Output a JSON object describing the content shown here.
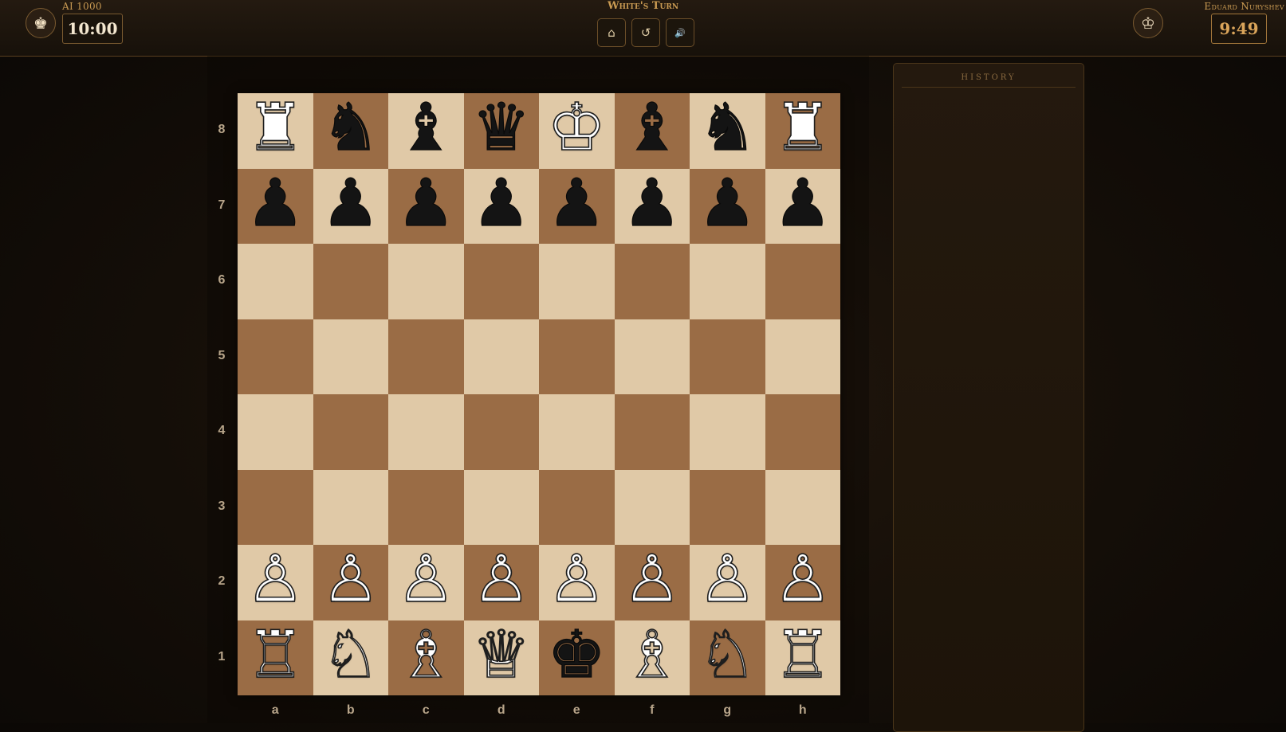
{
  "header": {
    "turn_text": "White's Turn",
    "opponent": {
      "name": "AI 1000",
      "clock": "10:00",
      "avatar_glyph": "♚"
    },
    "player": {
      "name": "Eduard Nuryshev",
      "clock": "9:49",
      "avatar_glyph": "♔"
    },
    "controls": {
      "home_icon": "⌂",
      "restart_icon": "↺",
      "sound_icon": "🔊"
    }
  },
  "board": {
    "light_color": "#e0c9a7",
    "dark_color": "#9a6c45",
    "ranks": [
      "8",
      "7",
      "6",
      "5",
      "4",
      "3",
      "2",
      "1"
    ],
    "files": [
      "a",
      "b",
      "c",
      "d",
      "e",
      "f",
      "g",
      "h"
    ],
    "rows": [
      [
        "♜",
        "♞",
        "♝",
        "♛",
        "♔",
        "♝",
        "♞",
        "♜"
      ],
      [
        "♟",
        "♟",
        "♟",
        "♟",
        "♟",
        "♟",
        "♟",
        "♟"
      ],
      [
        "",
        "",
        "",
        "",
        "",
        "",
        "",
        ""
      ],
      [
        "",
        "",
        "",
        "",
        "",
        "",
        "",
        ""
      ],
      [
        "",
        "",
        "",
        "",
        "",
        "",
        "",
        ""
      ],
      [
        "",
        "",
        "",
        "",
        "",
        "",
        "",
        ""
      ],
      [
        "♙",
        "♙",
        "♙",
        "♙",
        "♙",
        "♙",
        "♙",
        "♙"
      ],
      [
        "♖",
        "♘",
        "♗",
        "♕",
        "♚",
        "♗",
        "♘",
        "♖"
      ]
    ],
    "piece_colors": [
      [
        "white",
        "black",
        "black",
        "black",
        "white",
        "black",
        "black",
        "white"
      ],
      [
        "black",
        "black",
        "black",
        "black",
        "black",
        "black",
        "black",
        "black"
      ],
      [
        "",
        "",
        "",
        "",
        "",
        "",
        "",
        ""
      ],
      [
        "",
        "",
        "",
        "",
        "",
        "",
        "",
        ""
      ],
      [
        "",
        "",
        "",
        "",
        "",
        "",
        "",
        ""
      ],
      [
        "",
        "",
        "",
        "",
        "",
        "",
        "",
        ""
      ],
      [
        "white",
        "white",
        "white",
        "white",
        "white",
        "white",
        "white",
        "white"
      ],
      [
        "white",
        "white",
        "white",
        "white",
        "black",
        "white",
        "white",
        "white"
      ]
    ]
  },
  "history": {
    "title": "History",
    "moves": []
  }
}
